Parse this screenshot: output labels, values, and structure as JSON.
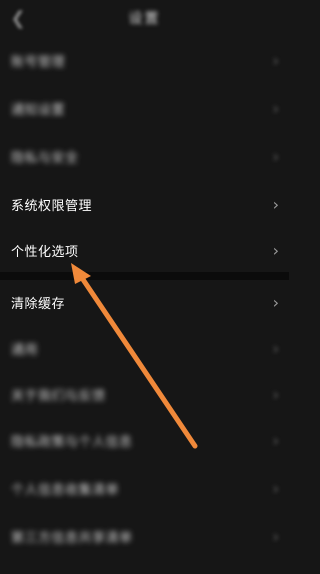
{
  "header": {
    "title": "设置",
    "back_icon": "back-arrow-icon"
  },
  "items": [
    {
      "label": "账号管理",
      "blurred": true
    },
    {
      "label": "通知设置",
      "blurred": true
    },
    {
      "label": "隐私与安全",
      "blurred": true
    },
    {
      "label": "系统权限管理",
      "blurred": false
    },
    {
      "label": "个性化选项",
      "blurred": false
    },
    {
      "label": "清除缓存",
      "blurred": false
    },
    {
      "label": "通用",
      "blurred": true
    },
    {
      "label": "关于我们与反馈",
      "blurred": true
    },
    {
      "label": "隐私政策与个人信息",
      "blurred": true
    },
    {
      "label": "个人信息收集清单",
      "blurred": true
    },
    {
      "label": "第三方信息共享清单",
      "blurred": true
    }
  ],
  "annotation": {
    "color": "#F0893A",
    "icon": "orange-arrow-annotation"
  }
}
